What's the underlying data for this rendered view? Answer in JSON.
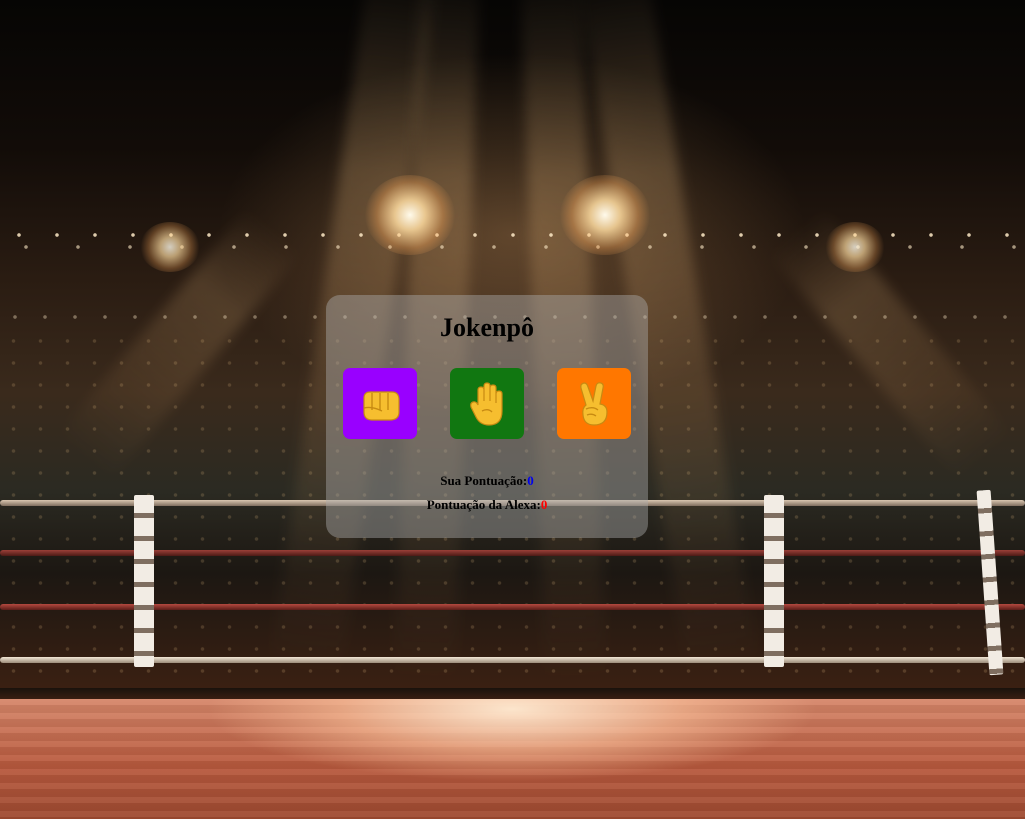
{
  "app": {
    "title": "Jokenpô"
  },
  "choices": [
    {
      "id": "rock",
      "icon": "fist-icon",
      "color": "#9900ff"
    },
    {
      "id": "paper",
      "icon": "raised-hand-icon",
      "color": "#117711"
    },
    {
      "id": "scissors",
      "icon": "victory-hand-icon",
      "color": "#ff7700"
    }
  ],
  "score": {
    "user_label": "Sua Pontuação:",
    "user_value": "0",
    "user_color": "#0000ee",
    "alexa_label": "Pontuação da Alexa:",
    "alexa_value": "0",
    "alexa_color": "#ff0000"
  }
}
